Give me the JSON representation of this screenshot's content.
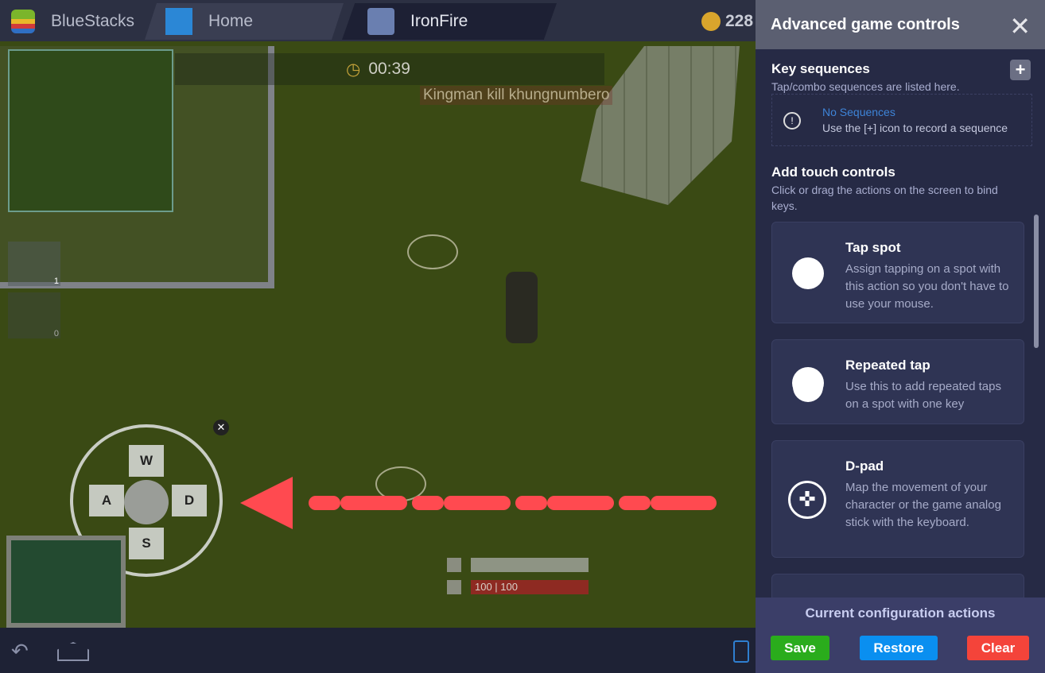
{
  "titlebar": {
    "app": "BlueStacks",
    "tabs": [
      {
        "label": "Home",
        "icon": "home-icon"
      },
      {
        "label": "IronFire",
        "icon": "game-icon"
      }
    ],
    "coins": "228"
  },
  "game": {
    "timer": "00:39",
    "kill_message": "Kingman kill khungnumbero",
    "items": [
      {
        "count": "1"
      },
      {
        "count": "0"
      }
    ],
    "dpad_keys": {
      "up": "W",
      "left": "A",
      "right": "D",
      "down": "S"
    },
    "health": "100 | 100",
    "health_color": "#a3262a",
    "arrow_color": "#ff4a50"
  },
  "panel": {
    "title": "Advanced game controls",
    "key_sequences": {
      "title": "Key sequences",
      "subtitle": "Tap/combo sequences are listed here.",
      "empty_title": "No Sequences",
      "empty_hint": "Use the [+] icon to record a sequence"
    },
    "touch": {
      "title": "Add touch controls",
      "subtitle": "Click or drag the actions on the screen to bind keys.",
      "cards": [
        {
          "title": "Tap spot",
          "desc": "Assign tapping on a spot with this action so you don't have to use your mouse.",
          "icon": "circle-icon"
        },
        {
          "title": "Repeated tap",
          "desc": "Use this to add repeated taps on a spot with one key",
          "icon": "stacked-circle-icon"
        },
        {
          "title": "D-pad",
          "desc": "Map the movement of your character or the game analog stick with the keyboard.",
          "icon": "dpad-icon"
        }
      ]
    },
    "footer": {
      "title": "Current configuration actions",
      "save": "Save",
      "restore": "Restore",
      "clear": "Clear",
      "colors": {
        "save": "#2aac1c",
        "restore": "#0a8ff0",
        "clear": "#f4443a"
      }
    }
  }
}
